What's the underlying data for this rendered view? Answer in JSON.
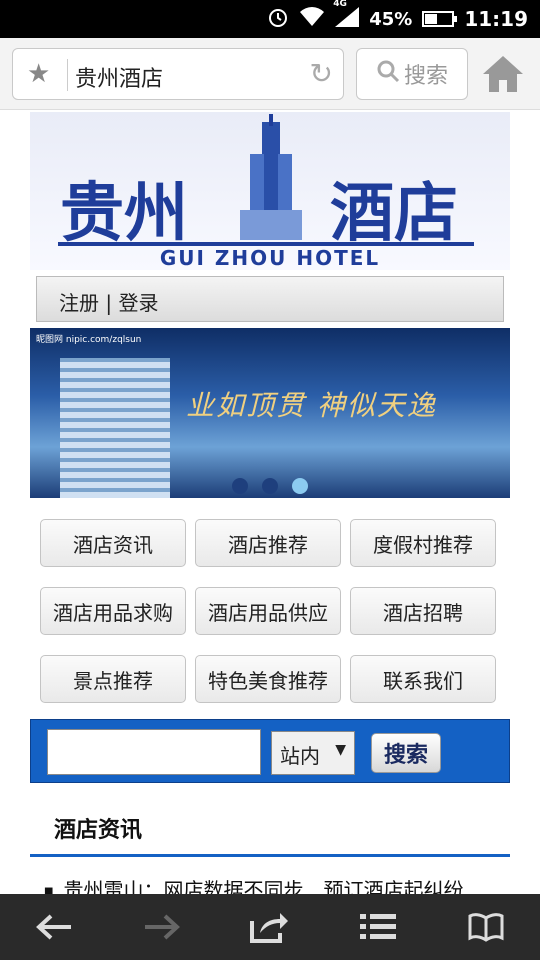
{
  "status": {
    "battery": "45%",
    "time": "11:19",
    "network": "4G"
  },
  "browser": {
    "url_text": "贵州酒店",
    "search_label": "搜索"
  },
  "logo": {
    "left_text": "贵州",
    "right_text": "酒店",
    "english": "GUI ZHOU HOTEL"
  },
  "login": {
    "text": "注册 | 登录"
  },
  "banner": {
    "watermark": "昵图网 nipic.com/zqlsun",
    "slogan": "业如顶贯  神似天逸",
    "dots": 3,
    "active_dot": 2
  },
  "menu": [
    {
      "label": "酒店资讯"
    },
    {
      "label": "酒店推荐"
    },
    {
      "label": "度假村推荐"
    },
    {
      "label": "酒店用品求购"
    },
    {
      "label": "酒店用品供应"
    },
    {
      "label": "酒店招聘"
    },
    {
      "label": "景点推荐"
    },
    {
      "label": "特色美食推荐"
    },
    {
      "label": "联系我们"
    }
  ],
  "search": {
    "input_value": "",
    "select_value": "站内",
    "button_label": "搜索"
  },
  "section": {
    "title": "酒店资讯"
  },
  "news": [
    {
      "text": "贵州雷山：网店数据不同步　预订酒店起纠纷"
    }
  ]
}
